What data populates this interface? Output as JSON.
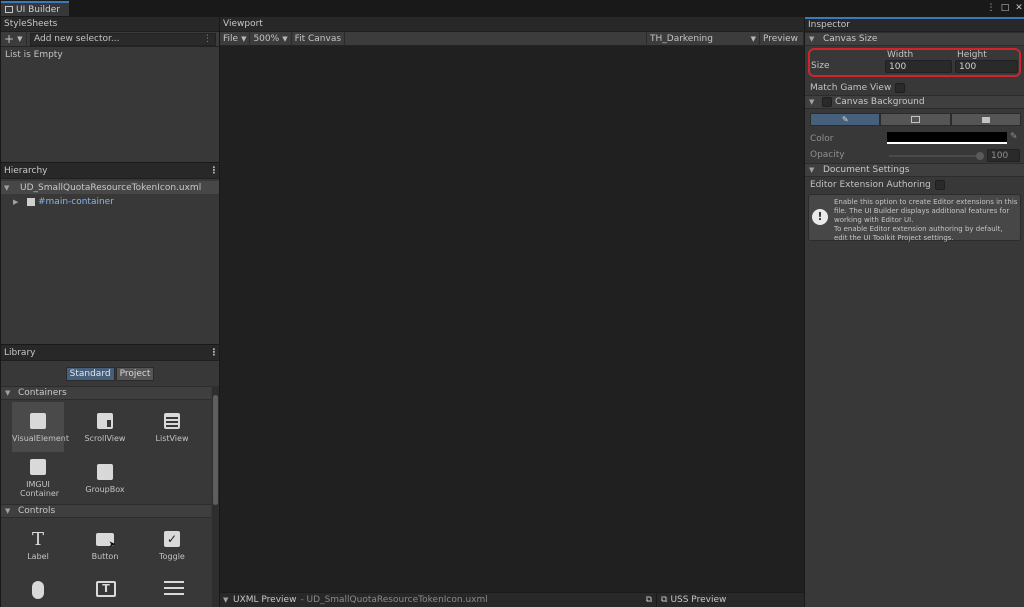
{
  "window": {
    "tab_title": "UI Builder",
    "controls": {
      "menu": "⋮",
      "maximize": "□",
      "close": "✕"
    }
  },
  "stylesheets": {
    "title": "StyleSheets",
    "add_button": "+",
    "selector_placeholder": "Add new selector...",
    "empty_text": "List is Empty"
  },
  "hierarchy": {
    "title": "Hierarchy",
    "document": "UD_SmallQuotaResourceTokenIcon.uxml",
    "root_element": "#main-container"
  },
  "library": {
    "title": "Library",
    "tabs": [
      {
        "label": "Standard",
        "active": true
      },
      {
        "label": "Project",
        "active": false
      }
    ],
    "sections": {
      "containers": {
        "title": "Containers",
        "items": [
          {
            "label": "VisualElement",
            "icon": "visual-element-icon"
          },
          {
            "label": "ScrollView",
            "icon": "scrollview-icon"
          },
          {
            "label": "ListView",
            "icon": "listview-icon"
          },
          {
            "label": "IMGUI Container",
            "icon": "imgui-icon"
          },
          {
            "label": "GroupBox",
            "icon": "groupbox-icon"
          }
        ]
      },
      "controls": {
        "title": "Controls",
        "items": [
          {
            "label": "Label",
            "icon": "label-icon"
          },
          {
            "label": "Button",
            "icon": "button-icon"
          },
          {
            "label": "Toggle",
            "icon": "toggle-icon"
          }
        ]
      }
    }
  },
  "viewport": {
    "title": "Viewport",
    "toolbar": {
      "file": "File",
      "zoom": "500%",
      "fit": "Fit Canvas",
      "theme": "TH_Darkening",
      "preview": "Preview"
    },
    "bottom": {
      "uxml_preview": "UXML Preview",
      "uxml_file": "- UD_SmallQuotaResourceTokenIcon.uxml",
      "uss_preview": "USS Preview"
    }
  },
  "inspector": {
    "title": "Inspector",
    "canvas_size": {
      "title": "Canvas Size",
      "size_label": "Size",
      "width_label": "Width",
      "height_label": "Height",
      "width_value": "100",
      "height_value": "100",
      "highlight_color": "#d0232a"
    },
    "match_game_view": "Match Game View",
    "canvas_background": {
      "title": "Canvas Background",
      "color_label": "Color",
      "opacity_label": "Opacity",
      "opacity_value": "100"
    },
    "document_settings": {
      "title": "Document Settings",
      "editor_extension": "Editor Extension Authoring",
      "help_line1": "Enable this option to create Editor extensions in this",
      "help_line2": "file. The UI Builder displays additional features for",
      "help_line3": "working with Editor UI.",
      "help_line4": "To enable Editor extension authoring by default,",
      "help_line5": "edit the UI Toolkit Project settings."
    }
  },
  "colors": {
    "accent": "#3a79bb",
    "panel": "#383838",
    "canvas": "#202020",
    "highlight": "#d0232a"
  }
}
